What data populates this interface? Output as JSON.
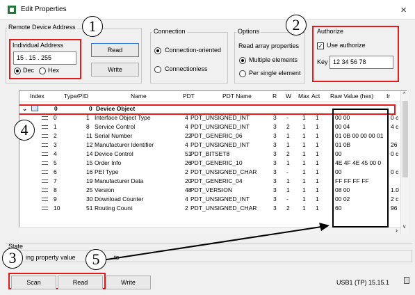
{
  "window": {
    "title": "Edit Properties",
    "close_glyph": "×"
  },
  "remote": {
    "group_label": "Remote Device Address",
    "individual_label": "Individual Address",
    "address_value": "15 . 15 . 255",
    "dec_label": "Dec",
    "hex_label": "Hex",
    "read_label": "Read",
    "write_label": "Write"
  },
  "connection": {
    "group_label": "Connection",
    "oriented_label": "Connection-oriented",
    "less_label": "Connectionless"
  },
  "options": {
    "group_label": "Options",
    "read_array_label": "Read array properties",
    "multiple_label": "Multiple elements",
    "single_label": "Per single element"
  },
  "authorize": {
    "group_label": "Authorize",
    "use_label": "Use authorize",
    "key_label": "Key",
    "key_value": "12 34 56 78"
  },
  "markers": [
    "1",
    "2",
    "3",
    "4",
    "5"
  ],
  "table": {
    "headers": [
      "Index",
      "Type/PID",
      "Name",
      "PDT",
      "PDT Name",
      "R",
      "W",
      "Max",
      "Act",
      "Raw Value (hex)",
      "Ir"
    ],
    "group_row": {
      "index": "0",
      "type": "0",
      "name": "Device Object"
    },
    "rows": [
      {
        "index": "0",
        "pid": "1",
        "name": "Interface Object Type",
        "pdt": "4",
        "pdt_name": "PDT_UNSIGNED_INT",
        "r": "3",
        "w": "-",
        "max": "1",
        "act": "1",
        "raw": "00 00",
        "ir": "0 c"
      },
      {
        "index": "1",
        "pid": "8",
        "name": "Service Control",
        "pdt": "4",
        "pdt_name": "PDT_UNSIGNED_INT",
        "r": "3",
        "w": "2",
        "max": "1",
        "act": "1",
        "raw": "00 04",
        "ir": "4 c"
      },
      {
        "index": "2",
        "pid": "11",
        "name": "Serial Number",
        "pdt": "22",
        "pdt_name": "PDT_GENERIC_06",
        "r": "3",
        "w": "1",
        "max": "1",
        "act": "1",
        "raw": "01 0B 00 00 00 01",
        "ir": ""
      },
      {
        "index": "3",
        "pid": "12",
        "name": "Manufacturer Identifier",
        "pdt": "4",
        "pdt_name": "PDT_UNSIGNED_INT",
        "r": "3",
        "w": "1",
        "max": "1",
        "act": "1",
        "raw": "01 0B",
        "ir": "26"
      },
      {
        "index": "4",
        "pid": "14",
        "name": "Device Control",
        "pdt": "51",
        "pdt_name": "PDT_BITSET8",
        "r": "3",
        "w": "2",
        "max": "1",
        "act": "1",
        "raw": "00",
        "ir": "0 c"
      },
      {
        "index": "5",
        "pid": "15",
        "name": "Order Info",
        "pdt": "26",
        "pdt_name": "PDT_GENERIC_10",
        "r": "3",
        "w": "1",
        "max": "1",
        "act": "1",
        "raw": "4E 4F 4E 45 00 0",
        "ir": ""
      },
      {
        "index": "6",
        "pid": "16",
        "name": "PEI Type",
        "pdt": "2",
        "pdt_name": "PDT_UNSIGNED_CHAR",
        "r": "3",
        "w": "-",
        "max": "1",
        "act": "1",
        "raw": "00",
        "ir": "0 c"
      },
      {
        "index": "7",
        "pid": "19",
        "name": "Manufacturer Data",
        "pdt": "20",
        "pdt_name": "PDT_GENERIC_04",
        "r": "3",
        "w": "1",
        "max": "1",
        "act": "1",
        "raw": "FF FF FF FF",
        "ir": ""
      },
      {
        "index": "8",
        "pid": "25",
        "name": "Version",
        "pdt": "48",
        "pdt_name": "PDT_VERSION",
        "r": "3",
        "w": "1",
        "max": "1",
        "act": "1",
        "raw": "08 00",
        "ir": "1.0"
      },
      {
        "index": "9",
        "pid": "30",
        "name": "Download Counter",
        "pdt": "4",
        "pdt_name": "PDT_UNSIGNED_INT",
        "r": "3",
        "w": "-",
        "max": "1",
        "act": "1",
        "raw": "00 02",
        "ir": "2 c"
      },
      {
        "index": "10",
        "pid": "51",
        "name": "Routing Count",
        "pdt": "2",
        "pdt_name": "PDT_UNSIGNED_CHAR",
        "r": "3",
        "w": "2",
        "max": "1",
        "act": "1",
        "raw": "60",
        "ir": "96"
      }
    ]
  },
  "state": {
    "label": "State",
    "text": "ing property value",
    "trail": "te"
  },
  "footer": {
    "scan_label": "Scan",
    "read_label": "Read",
    "write_label": "Write",
    "status_right": "USB1 (TP) 15.15.1"
  },
  "colors": {
    "highlight": "#e31b1b",
    "table_bg": "#ffffff",
    "header_bg": "#f0f0f0"
  }
}
